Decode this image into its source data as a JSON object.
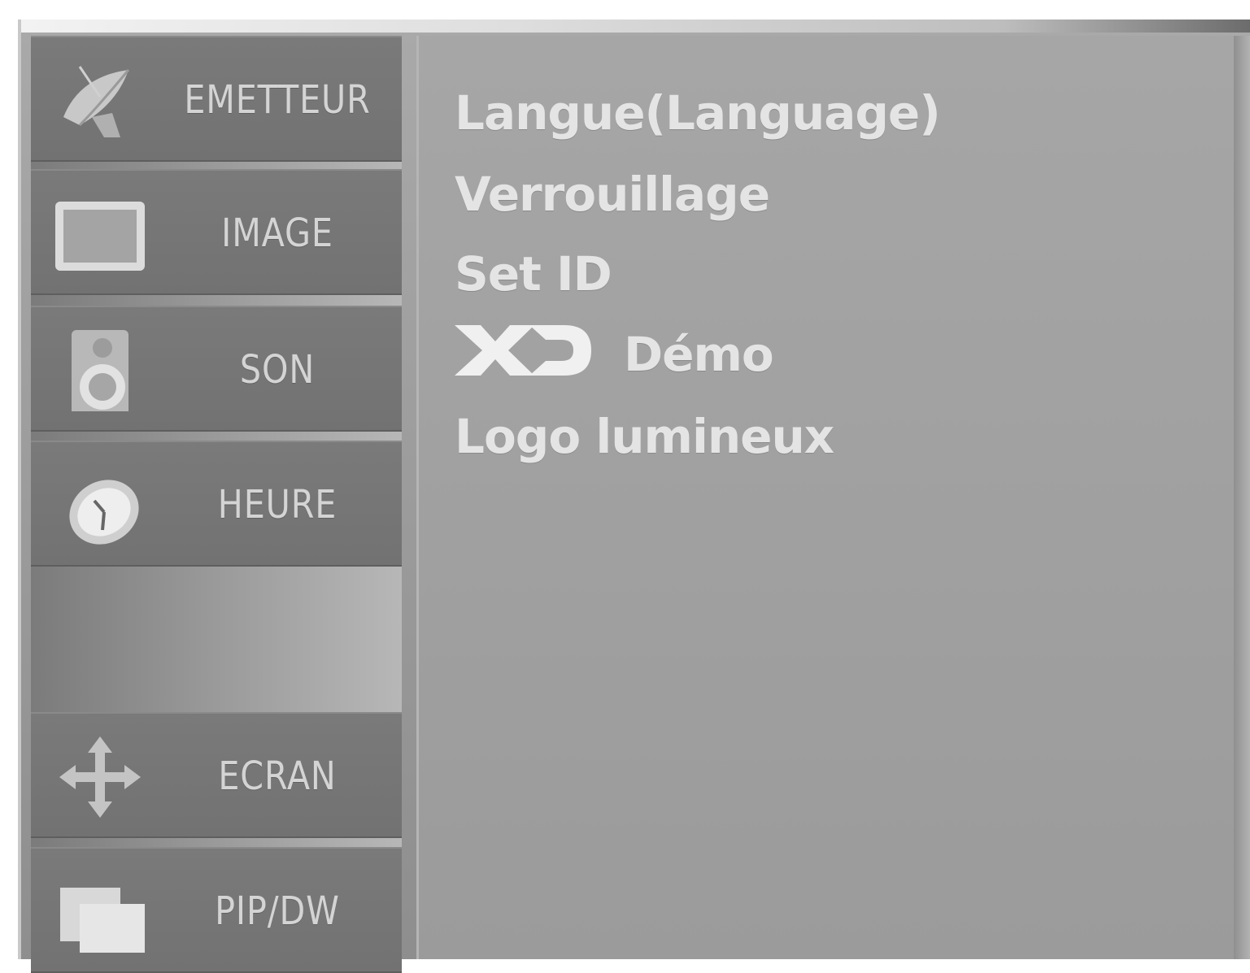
{
  "sidebar": {
    "items": [
      {
        "label": "EMETTEUR",
        "icon": "satellite-dish-icon"
      },
      {
        "label": "IMAGE",
        "icon": "picture-screen-icon"
      },
      {
        "label": "SON",
        "icon": "speaker-icon"
      },
      {
        "label": "HEURE",
        "icon": "clock-icon"
      },
      {
        "label": "ECRAN",
        "icon": "move-arrows-icon"
      },
      {
        "label": "PIP/DW",
        "icon": "pip-windows-icon"
      }
    ]
  },
  "main": {
    "items": [
      {
        "label": "Langue(Language)"
      },
      {
        "label": "Verrouillage"
      },
      {
        "label": "Set ID"
      },
      {
        "label": "Démo",
        "logo_text": "XD"
      },
      {
        "label": "Logo lumineux"
      }
    ]
  },
  "colors": {
    "tile": "#767676",
    "panel": "#a2a2a2",
    "label": "#d4d4d4",
    "text": "#e4e4e4"
  }
}
